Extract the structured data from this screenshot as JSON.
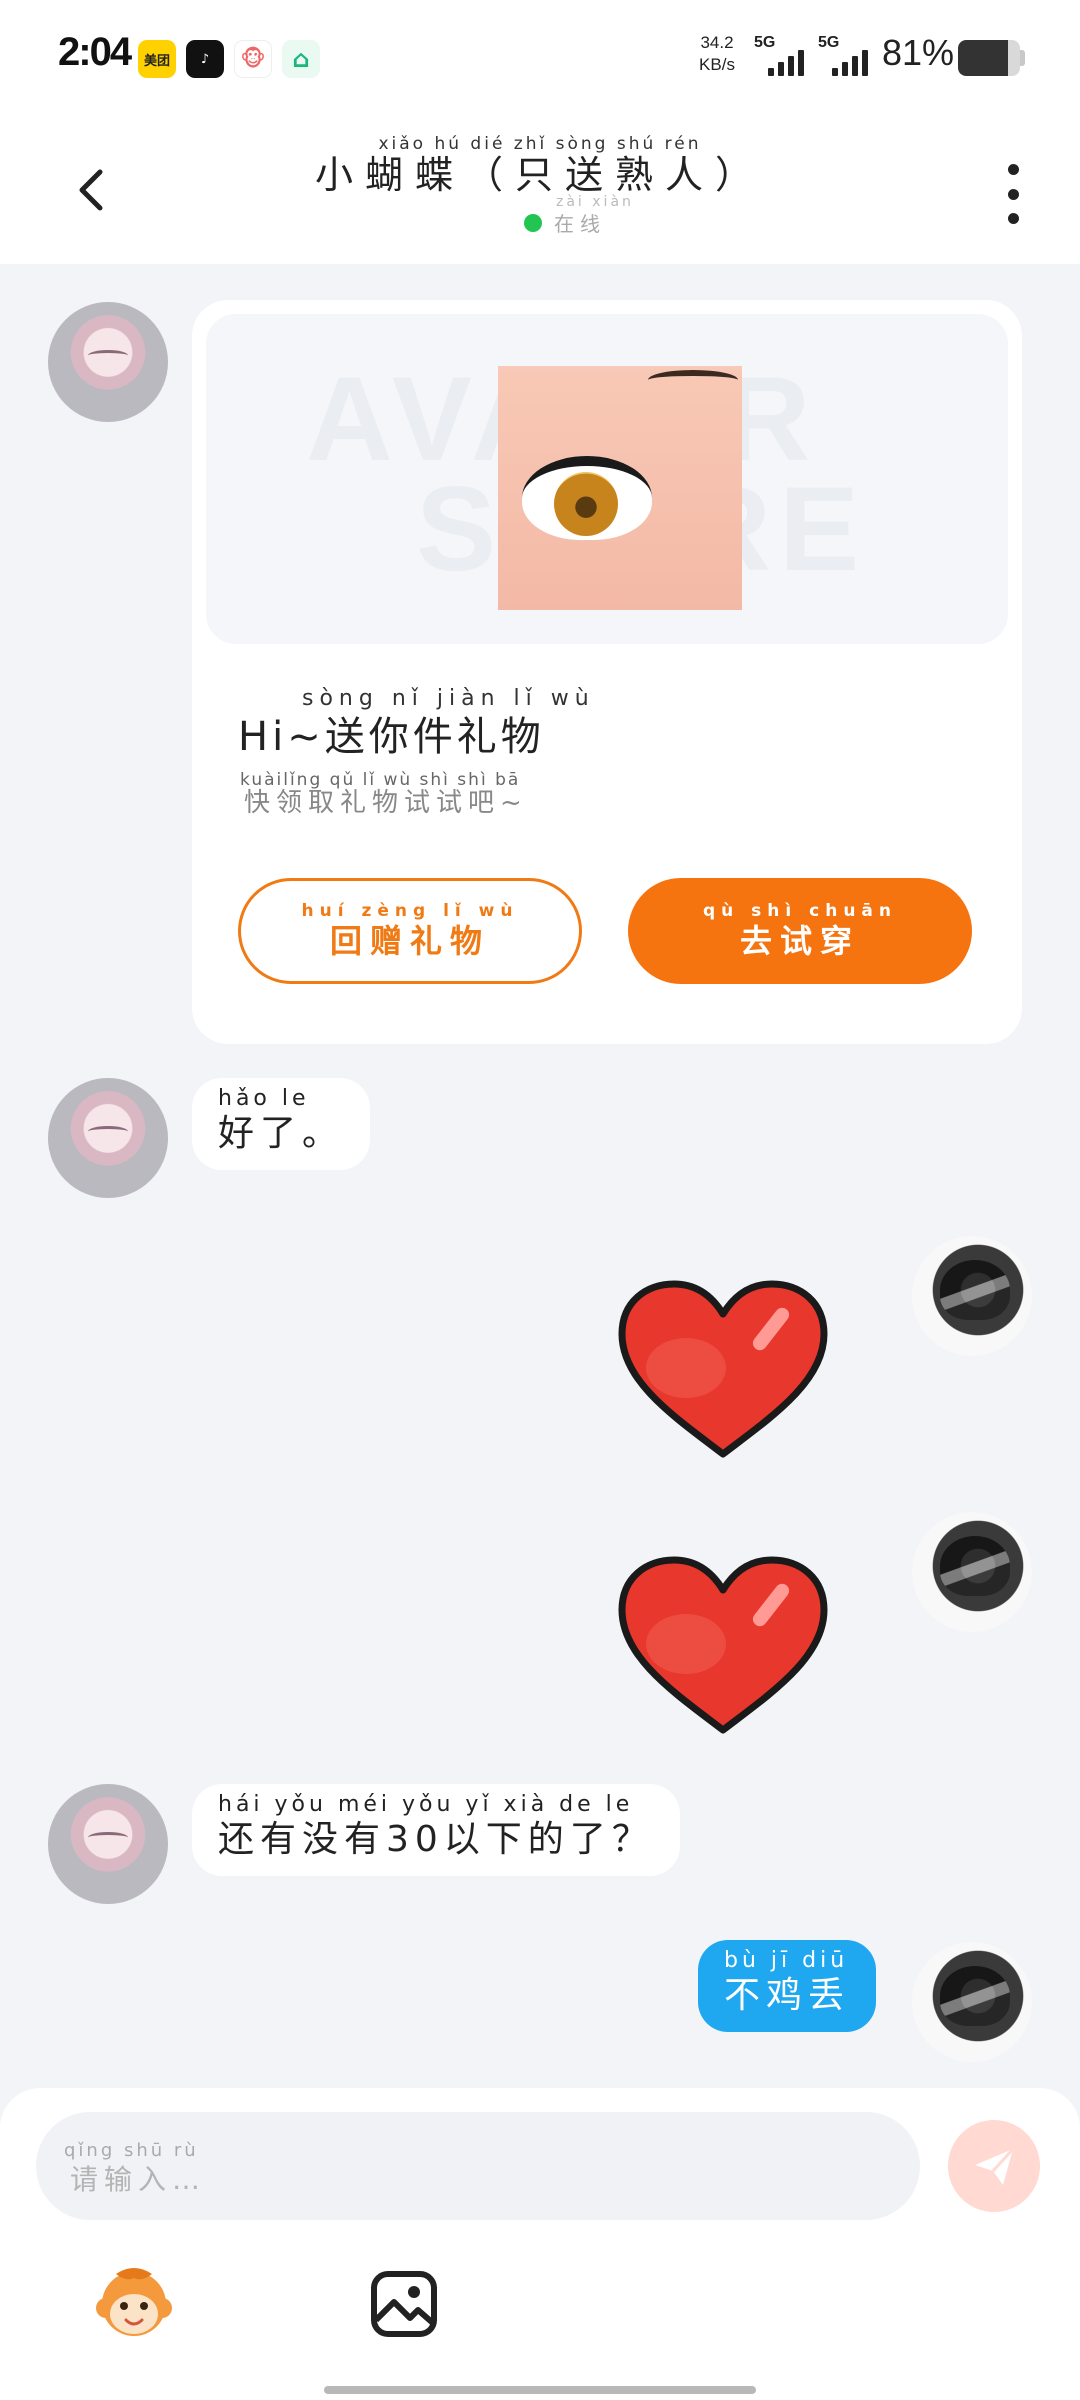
{
  "status_bar": {
    "time": "2:04",
    "apps": [
      {
        "icon": "meituan-icon",
        "label": "美团"
      },
      {
        "icon": "tiktok-icon",
        "label": "♪"
      },
      {
        "icon": "monkey-app-icon",
        "label": "🐵"
      },
      {
        "icon": "home-app-icon",
        "label": "⌂"
      }
    ],
    "net_speed_value": "34.2",
    "net_speed_unit": "KB/s",
    "signal_1": "5G",
    "signal_2": "5G",
    "battery": "81%",
    "battery_level": 0.81
  },
  "header": {
    "title": "小蝴蝶（只送熟人）",
    "title_pinyin": "xiǎo hú dié    zhǐ sòng shú rén",
    "status": "在线",
    "status_pinyin": "zài xiàn"
  },
  "gift_card": {
    "banner_watermark_1": "AVATAR",
    "banner_watermark_2": "STORE",
    "title": "Hi~送你件礼物",
    "title_pinyin": "sòng nǐ jiàn lǐ wù",
    "subtitle": "快领取礼物试试吧~",
    "subtitle_pinyin": "kuàilǐng qǔ  lǐ  wù shì shì  bā",
    "return_gift_label": "回赠礼物",
    "return_gift_pinyin": "huí zèng lǐ wù",
    "try_on_label": "去试穿",
    "try_on_pinyin": "qù shì chuān"
  },
  "messages": [
    {
      "from": "contact",
      "text": "好了。",
      "pinyin": "hǎo  le"
    },
    {
      "from": "me",
      "type": "sticker",
      "sticker": "heart-icon"
    },
    {
      "from": "me",
      "type": "sticker",
      "sticker": "heart-icon"
    },
    {
      "from": "contact",
      "text": "还有没有30以下的了？",
      "pinyin": "hái yǒu méi yǒu      yǐ  xià  de  le"
    },
    {
      "from": "me",
      "text": "不鸡丢",
      "pinyin": "bù  jī  diū"
    }
  ],
  "composer": {
    "placeholder": "请输入…",
    "placeholder_pinyin": "qǐng shū rù"
  },
  "colors": {
    "accent_orange": "#f5740f",
    "my_bubble": "#1fa7f0",
    "online_dot": "#23c552",
    "background": "#f2f4f8"
  }
}
